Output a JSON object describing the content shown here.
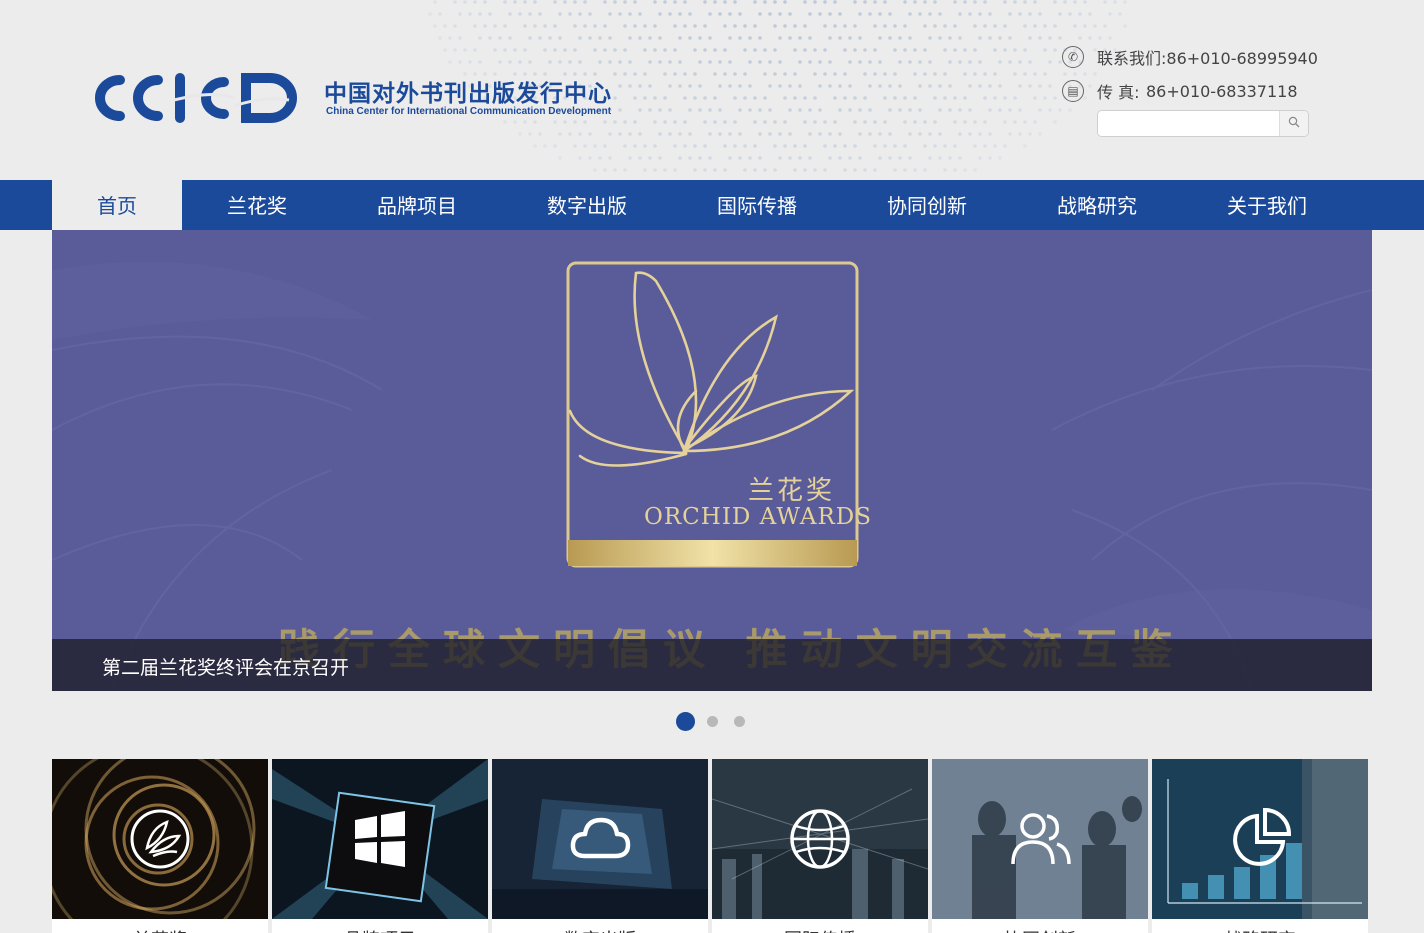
{
  "header": {
    "logo_mark": "CCICD",
    "logo_cn": "中国对外书刊出版发行中心",
    "logo_en": "China Center for International Communication Development",
    "contact_tel": "联系我们:86+010-68995940",
    "contact_fax_label": "传    真:",
    "contact_fax_value": "86+010-68337118",
    "search_placeholder": "",
    "icons": {
      "tel": "phone-icon",
      "fax": "fax-icon",
      "search": "search-icon"
    }
  },
  "nav": {
    "items": [
      {
        "label": "首页",
        "active": true
      },
      {
        "label": "兰花奖"
      },
      {
        "label": "品牌项目"
      },
      {
        "label": "数字出版"
      },
      {
        "label": "国际传播"
      },
      {
        "label": "协同创新"
      },
      {
        "label": "战略研究"
      },
      {
        "label": "关于我们"
      }
    ]
  },
  "banner": {
    "award_cn": "兰花奖",
    "award_en": "ORCHID AWARDS",
    "slogan": "践行全球文明倡议  推动文明交流互鉴",
    "caption": "第二届兰花奖终评会在京召开",
    "slide_count": 3,
    "active_slide": 1
  },
  "tiles": [
    {
      "label": "兰花奖",
      "icon": "orchid-icon"
    },
    {
      "label": "品牌项目",
      "icon": "windows-icon"
    },
    {
      "label": "数字出版",
      "icon": "cloud-icon"
    },
    {
      "label": "国际传播",
      "icon": "globe-icon"
    },
    {
      "label": "协同创新",
      "icon": "people-icon"
    },
    {
      "label": "战略研究",
      "icon": "pie-chart-icon"
    }
  ],
  "colors": {
    "brand": "#1c4a9a",
    "banner": "#5a5b99",
    "gold": "#e4d29a",
    "background": "#ececed"
  }
}
